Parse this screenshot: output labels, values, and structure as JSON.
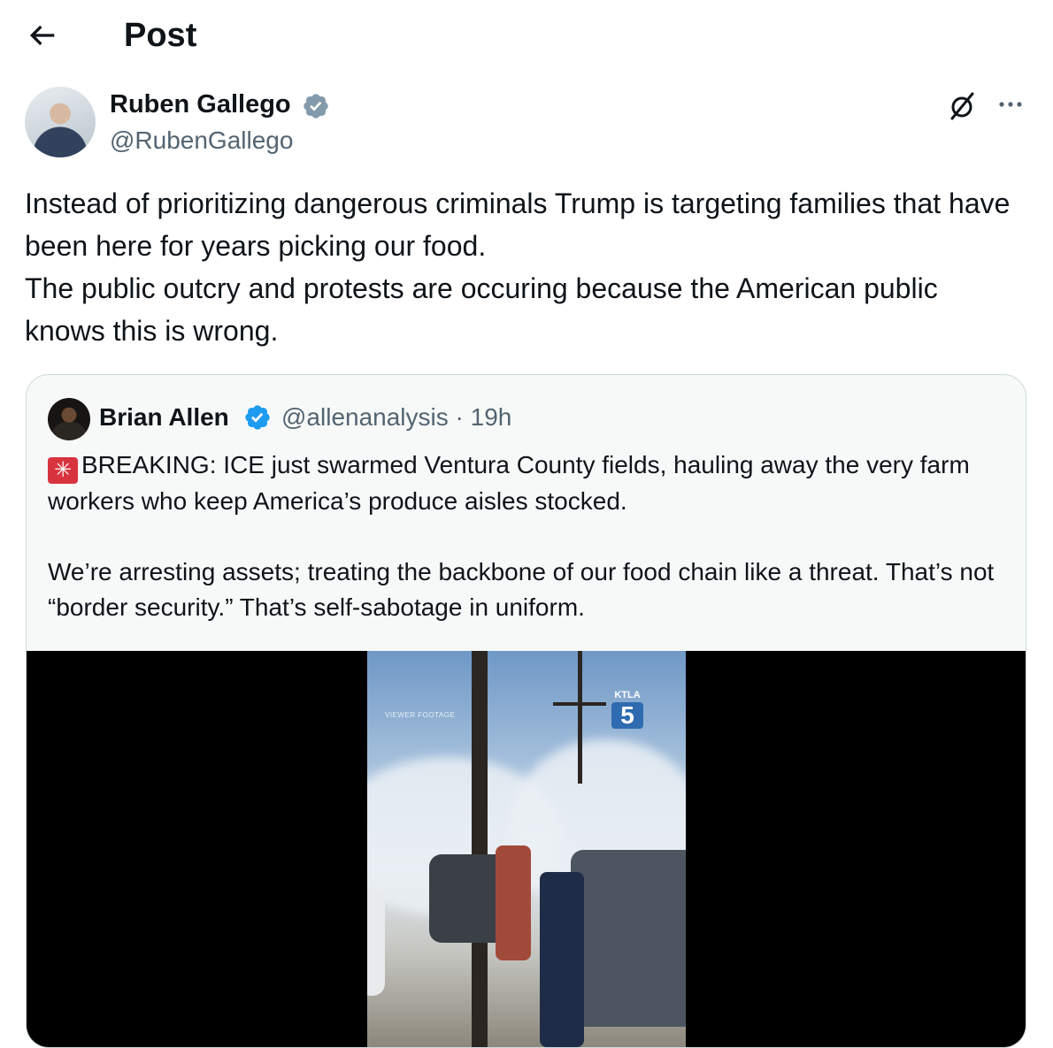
{
  "header": {
    "title": "Post"
  },
  "author": {
    "name": "Ruben Gallego",
    "handle": "@RubenGallego"
  },
  "post": {
    "paragraphs": [
      "Instead of prioritizing dangerous criminals Trump is targeting families that have been here for years picking our food.",
      "The public outcry and protests are occuring because the American public knows this is wrong."
    ]
  },
  "quote": {
    "author_name": "Brian Allen",
    "handle_time": "@allenanalysis · 19h",
    "paragraphs": [
      "BREAKING: ICE just swarmed Ventura County fields, hauling away the very farm workers who keep America’s produce aisles stocked.",
      "We’re arresting assets; treating the backbone of our food chain like a threat. That’s not “border security.” That’s self-sabotage in uniform."
    ],
    "video": {
      "watermark": "VIEWER FOOTAGE",
      "logo_text": "KTLA",
      "logo_number": "5"
    }
  },
  "icons": {
    "back": "arrow-left-icon",
    "verified": "verified-badge-icon",
    "grok": "grok-icon",
    "more": "more-icon",
    "siren": "siren-emoji-icon"
  },
  "colors": {
    "verified": "#1d9bf0",
    "secondary_text": "#536471",
    "card_border": "#cfd9de",
    "card_bg": "#f7f9f9"
  }
}
